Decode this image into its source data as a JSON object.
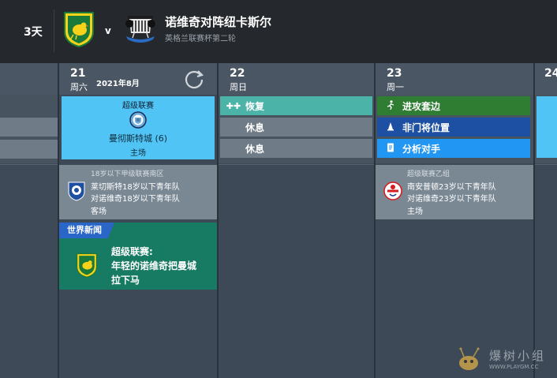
{
  "header": {
    "days_label": "3天",
    "vs_label": "v",
    "match_title": "诺维奇对阵纽卡斯尔",
    "match_subtitle": "英格兰联赛杯第二轮"
  },
  "columns": {
    "day21": {
      "num": "21",
      "name": "周六",
      "month": "2021年8月",
      "match": {
        "competition": "超级联赛",
        "opponent": "曼彻斯特城 (6)",
        "venue": "主场"
      },
      "youth": {
        "competition": "18岁以下甲级联赛南区",
        "line1": "莱切斯特18岁以下青年队",
        "line2": "对诺维奇18岁以下青年队",
        "venue": "客场"
      },
      "news": {
        "tag": "世界新闻",
        "line1": "超级联赛:",
        "line2": "年轻的诺维奇把曼城",
        "line3": "拉下马"
      }
    },
    "day22": {
      "num": "22",
      "name": "周日",
      "events": [
        {
          "icon": "recovery-icon",
          "label": "恢复"
        },
        {
          "icon": "",
          "label": "休息"
        },
        {
          "icon": "",
          "label": "休息"
        }
      ]
    },
    "day23": {
      "num": "23",
      "name": "周一",
      "events": [
        {
          "icon": "running-icon",
          "label": "进攻套边"
        },
        {
          "icon": "cone-icon",
          "label": "非门将位置"
        },
        {
          "icon": "document-icon",
          "label": "分析对手"
        }
      ],
      "youth": {
        "competition": "超级联赛乙组",
        "line1": "南安普顿23岁以下青年队",
        "line2": "对诺维奇23岁以下青年队",
        "venue": "主场"
      }
    },
    "day24": {
      "num": "24"
    }
  },
  "watermark": {
    "text": "爆树小组",
    "url": "WWW.PLAYGM.CC"
  },
  "colors": {
    "header_bg": "#25282c",
    "match_card": "#50c4f5",
    "news_bg": "#177a63",
    "news_tag": "#2a66c7",
    "recovery": "#4bb3a8",
    "attack": "#2e7d32",
    "outfield": "#1d4fa3",
    "analysis": "#2196f3"
  }
}
